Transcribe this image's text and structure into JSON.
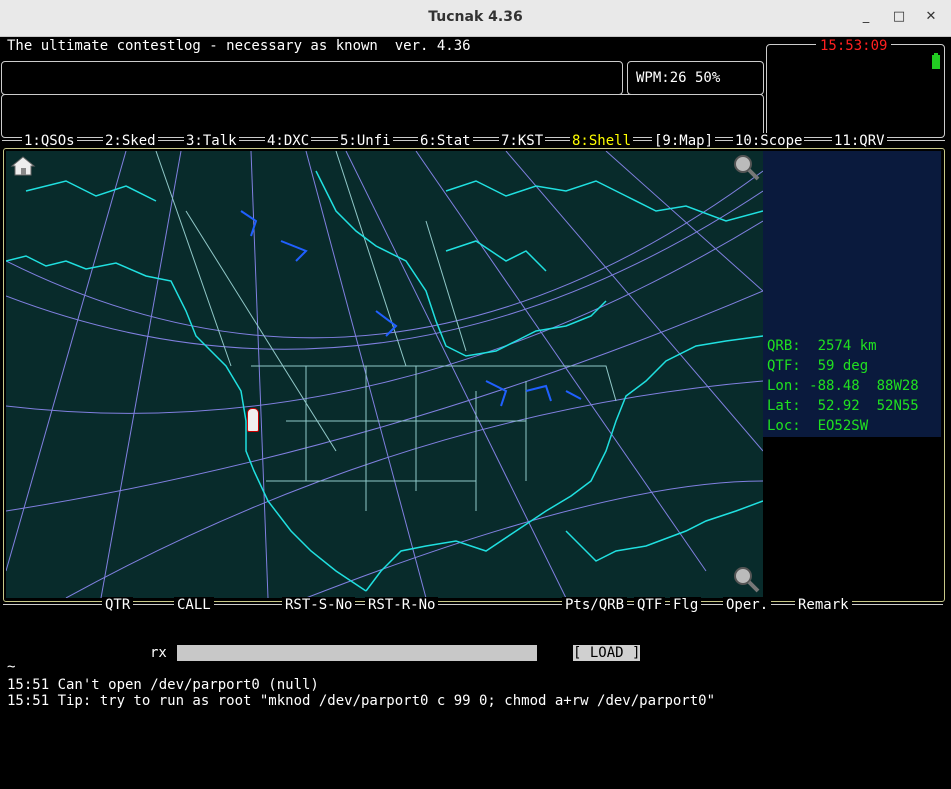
{
  "window": {
    "title": "Tucnak 4.36",
    "minimize": "_",
    "maximize": "□",
    "close": "✕"
  },
  "header": {
    "banner": "The ultimate contestlog - necessary as known  ver. 4.36",
    "wpm": "WPM:26 50%",
    "clock": "15:53:09"
  },
  "tabs": [
    {
      "label": "1:QSOs"
    },
    {
      "label": "2:Sked"
    },
    {
      "label": "3:Talk"
    },
    {
      "label": "4:DXC"
    },
    {
      "label": "5:Unfi"
    },
    {
      "label": "6:Stat"
    },
    {
      "label": "7:KST"
    },
    {
      "label": "8:Shell"
    },
    {
      "label": "[9:Map]"
    },
    {
      "label": "10:Scope"
    },
    {
      "label": "11:QRV"
    }
  ],
  "info": {
    "qrb_label": "QRB:",
    "qrb_value": "2574 km",
    "qtf_label": "QTF:",
    "qtf_value": "59 deg",
    "lon_label": "Lon:",
    "lon_value": "-88.48",
    "lon_dms": "88W28",
    "lat_label": "Lat:",
    "lat_value": "52.92",
    "lat_dms": "52N55",
    "loc_label": "Loc:",
    "loc_value": "EO52SW"
  },
  "columns": {
    "qtr": "QTR",
    "call": "CALL",
    "rst_s": "RST-S-No",
    "rst_r": "RST-R-No",
    "pts": "Pts/QRB",
    "qtf": "QTF",
    "flg": "Flg",
    "oper": "Oper.",
    "remark": "Remark"
  },
  "rx": {
    "label": "rx",
    "load": "[ LOAD ]"
  },
  "log": {
    "tilde": "~",
    "line1": "15:51 Can't open /dev/parport0 (null)",
    "line2": "15:51 Tip: try to run as root \"mknod /dev/parport0 c 99 0; chmod a+rw /dev/parport0\""
  },
  "colors": {
    "map_bg": "#082b2b",
    "coast": "#20e0e0",
    "grid": "#8080e0",
    "border": "#90c8c8",
    "lakes": "#2060ff",
    "info_bg": "#0a1a3d",
    "info_text": "#20e020",
    "clock": "#ff2020",
    "active_tab": "#ffff00"
  },
  "icons": {
    "home": "home-icon",
    "zoom_in": "zoom-in-icon",
    "zoom_out": "zoom-out-icon",
    "battery": "battery-icon",
    "marker": "location-marker-icon"
  }
}
